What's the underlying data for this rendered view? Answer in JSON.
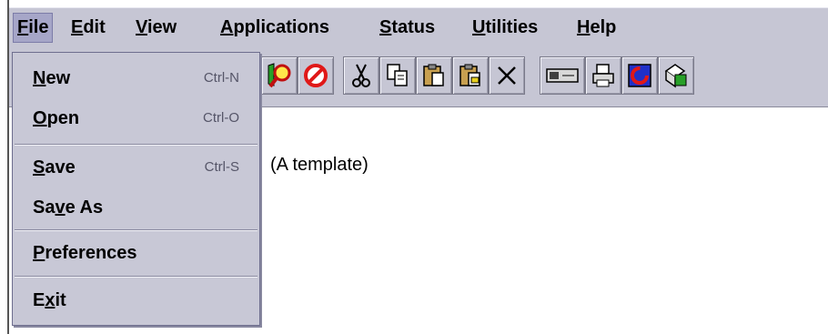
{
  "menubar": {
    "items": [
      {
        "pre": "",
        "mn": "F",
        "post": "ile"
      },
      {
        "pre": "",
        "mn": "E",
        "post": "dit"
      },
      {
        "pre": "",
        "mn": "V",
        "post": "iew"
      },
      {
        "pre": "",
        "mn": "A",
        "post": "pplications"
      },
      {
        "pre": "",
        "mn": "S",
        "post": "tatus"
      },
      {
        "pre": "",
        "mn": "U",
        "post": "tilities"
      },
      {
        "pre": "",
        "mn": "H",
        "post": "elp"
      }
    ]
  },
  "file_menu": {
    "items": [
      {
        "pre": "",
        "mn": "N",
        "post": "ew",
        "accel": "Ctrl-N"
      },
      {
        "pre": "",
        "mn": "O",
        "post": "pen",
        "accel": "Ctrl-O"
      },
      {
        "pre": "",
        "mn": "S",
        "post": "ave",
        "accel": "Ctrl-S"
      },
      {
        "pre": "Sa",
        "mn": "v",
        "post": "e As",
        "accel": ""
      },
      {
        "pre": "",
        "mn": "P",
        "post": "references",
        "accel": ""
      },
      {
        "pre": "E",
        "mn": "x",
        "post": "it",
        "accel": ""
      }
    ]
  },
  "toolbar": {
    "buttons": [
      {
        "icon": "search-icon"
      },
      {
        "icon": "stop-icon"
      },
      {
        "icon": "cut-icon"
      },
      {
        "icon": "copy-icon"
      },
      {
        "icon": "paste-icon"
      },
      {
        "icon": "paste-special-icon"
      },
      {
        "icon": "delete-icon"
      },
      {
        "icon": "device-icon"
      },
      {
        "icon": "print-icon"
      },
      {
        "icon": "app-c-icon"
      },
      {
        "icon": "document-d-icon"
      }
    ]
  },
  "content": {
    "text": "(A template)"
  },
  "colors": {
    "chrome": "#c6c6d4",
    "active_menu": "#a6a6c8",
    "stop_red": "#e01818",
    "magnifier_yellow": "#e8d020"
  }
}
